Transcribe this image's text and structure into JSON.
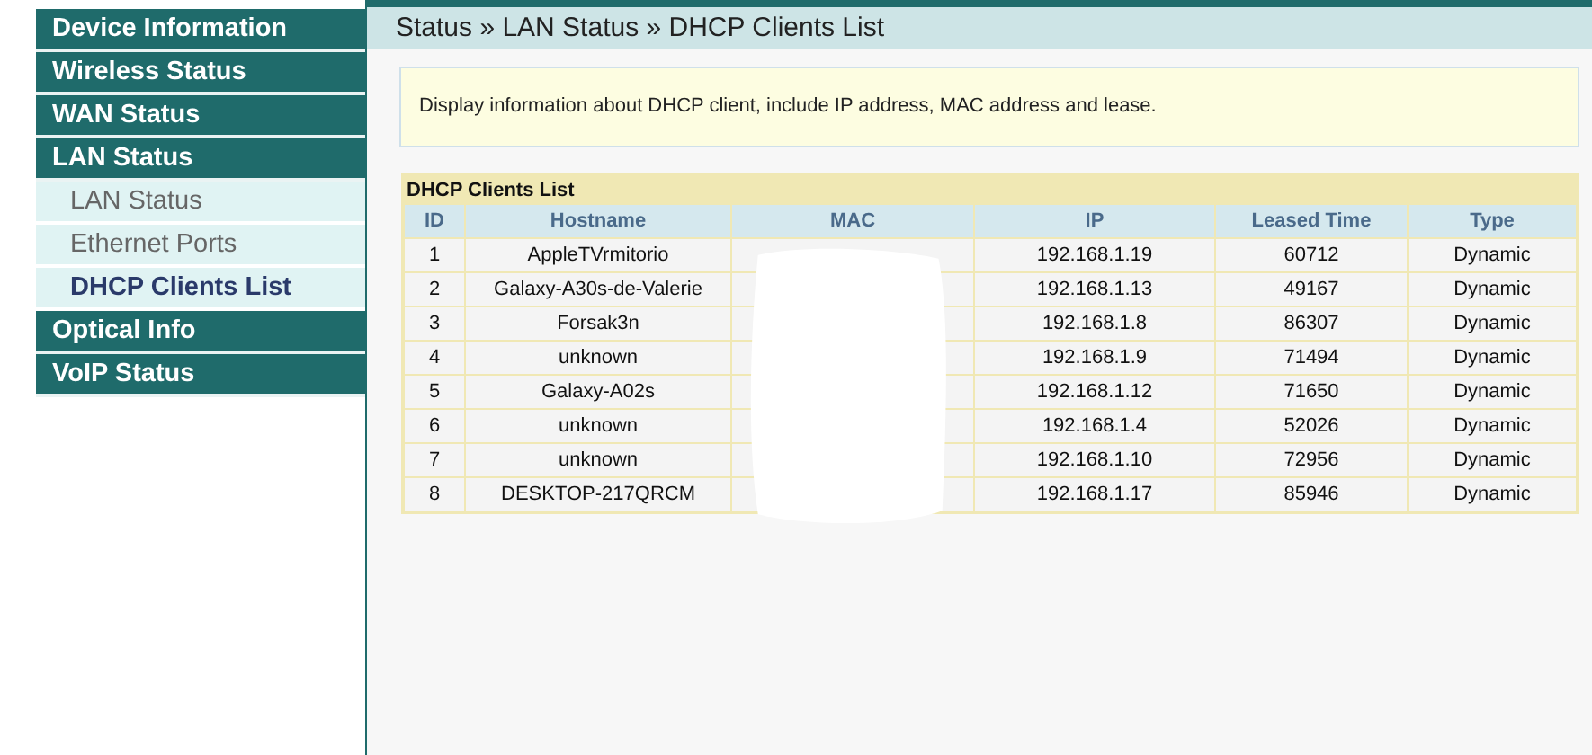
{
  "sidebar": {
    "items": [
      {
        "label": "Device Information",
        "selected": false
      },
      {
        "label": "Wireless Status",
        "selected": false
      },
      {
        "label": "WAN Status",
        "selected": false
      },
      {
        "label": "LAN Status",
        "selected": false,
        "children": [
          {
            "label": "LAN Status",
            "selected": false
          },
          {
            "label": "Ethernet Ports",
            "selected": false
          },
          {
            "label": "DHCP Clients List",
            "selected": true
          }
        ]
      },
      {
        "label": "Optical Info",
        "selected": false
      },
      {
        "label": "VoIP Status",
        "selected": false
      }
    ]
  },
  "breadcrumb": "Status » LAN Status » DHCP Clients List",
  "info": "Display information about DHCP client, include IP address, MAC address and lease.",
  "table": {
    "title": "DHCP Clients List",
    "columns": [
      "ID",
      "Hostname",
      "MAC",
      "IP",
      "Leased Time",
      "Type"
    ],
    "rows": [
      [
        "1",
        "AppleTVrmitorio",
        "",
        "192.168.1.19",
        "60712",
        "Dynamic"
      ],
      [
        "2",
        "Galaxy-A30s-de-Valerie",
        "",
        "192.168.1.13",
        "49167",
        "Dynamic"
      ],
      [
        "3",
        "Forsak3n",
        "",
        "192.168.1.8",
        "86307",
        "Dynamic"
      ],
      [
        "4",
        "unknown",
        "",
        "192.168.1.9",
        "71494",
        "Dynamic"
      ],
      [
        "5",
        "Galaxy-A02s",
        "",
        "192.168.1.12",
        "71650",
        "Dynamic"
      ],
      [
        "6",
        "unknown",
        "",
        "192.168.1.4",
        "52026",
        "Dynamic"
      ],
      [
        "7",
        "unknown",
        "",
        "192.168.1.10",
        "72956",
        "Dynamic"
      ],
      [
        "8",
        "DESKTOP-217QRCM",
        "",
        "192.168.1.17",
        "85946",
        "Dynamic"
      ]
    ]
  }
}
